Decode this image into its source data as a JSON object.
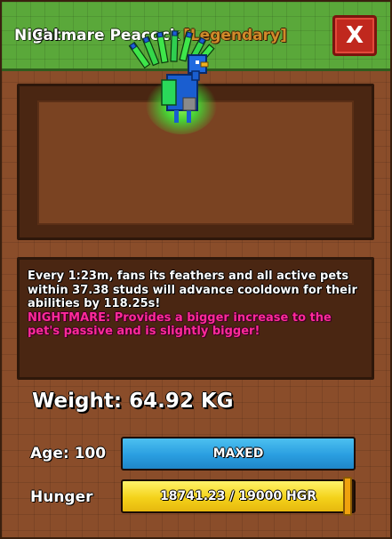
{
  "header": {
    "title": "Nightmare Peacock",
    "rarity": "[Legendary]",
    "close_label": "X"
  },
  "pet": {
    "name": "Cal",
    "art_icon": "peacock-pet-icon",
    "glow_color": "#39ff3a"
  },
  "description": {
    "main": "Every 1:23m, fans its feathers and all active pets within 37.38 studs will advance cooldown for their abilities by 118.25s!",
    "special": "NIGHTMARE: Provides a bigger increase to the pet's passive and is slightly bigger!"
  },
  "stats": {
    "weight": "Weight: 64.92 KG",
    "age_label": "Age: 100",
    "age_bar_text": "MAXED",
    "age_progress": 1.0,
    "hunger_label": "Hunger",
    "hunger_bar_text": "18741.23 / 19000 HGR",
    "hunger_progress": 0.9864
  },
  "colors": {
    "title_green": "#5aa83a",
    "panel_brown": "#8a4d2a",
    "rarity_orange": "#d08a2a",
    "nightmare_pink": "#ff2a9a",
    "close_red": "#c0281e",
    "age_blue": "#2a9ee0",
    "hunger_yellow": "#f4d21a"
  }
}
